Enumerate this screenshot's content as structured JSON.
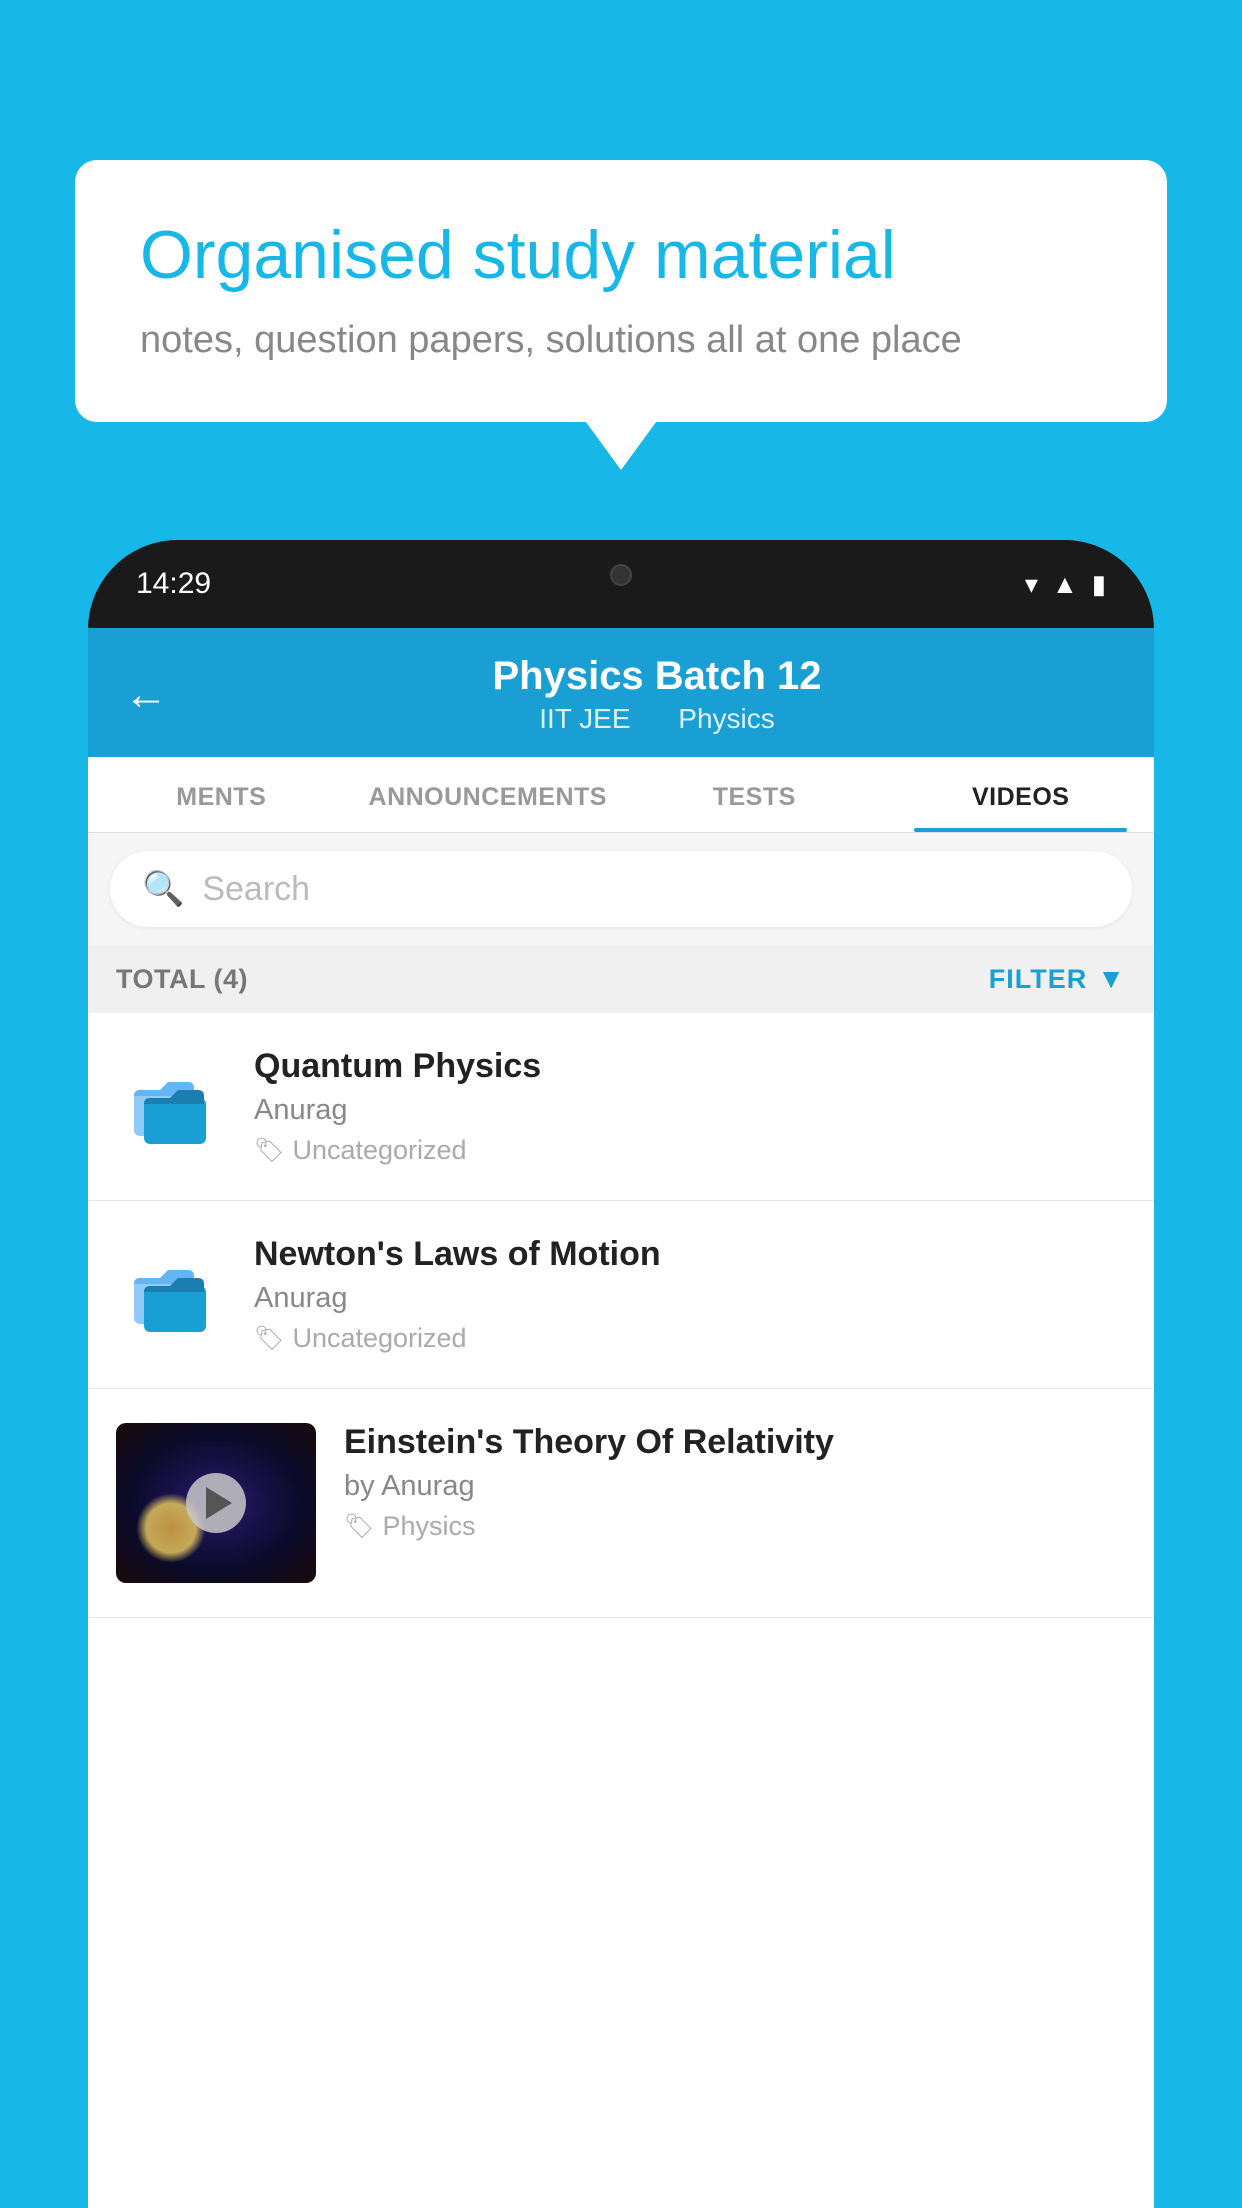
{
  "background": {
    "color": "#17b8e8"
  },
  "speech_bubble": {
    "title": "Organised study material",
    "subtitle": "notes, question papers, solutions all at one place"
  },
  "phone": {
    "status_bar": {
      "time": "14:29",
      "icons": [
        "wifi",
        "signal",
        "battery"
      ]
    },
    "header": {
      "back_label": "←",
      "title": "Physics Batch 12",
      "subtitle_part1": "IIT JEE",
      "subtitle_part2": "Physics"
    },
    "tabs": [
      {
        "label": "MENTS",
        "active": false
      },
      {
        "label": "ANNOUNCEMENTS",
        "active": false
      },
      {
        "label": "TESTS",
        "active": false
      },
      {
        "label": "VIDEOS",
        "active": true
      }
    ],
    "search": {
      "placeholder": "Search"
    },
    "filter_bar": {
      "total_label": "TOTAL (4)",
      "filter_label": "FILTER"
    },
    "videos": [
      {
        "id": 1,
        "title": "Quantum Physics",
        "author": "Anurag",
        "tag": "Uncategorized",
        "type": "folder"
      },
      {
        "id": 2,
        "title": "Newton's Laws of Motion",
        "author": "Anurag",
        "tag": "Uncategorized",
        "type": "folder"
      },
      {
        "id": 3,
        "title": "Einstein's Theory Of Relativity",
        "author": "by Anurag",
        "tag": "Physics",
        "type": "video"
      }
    ]
  }
}
